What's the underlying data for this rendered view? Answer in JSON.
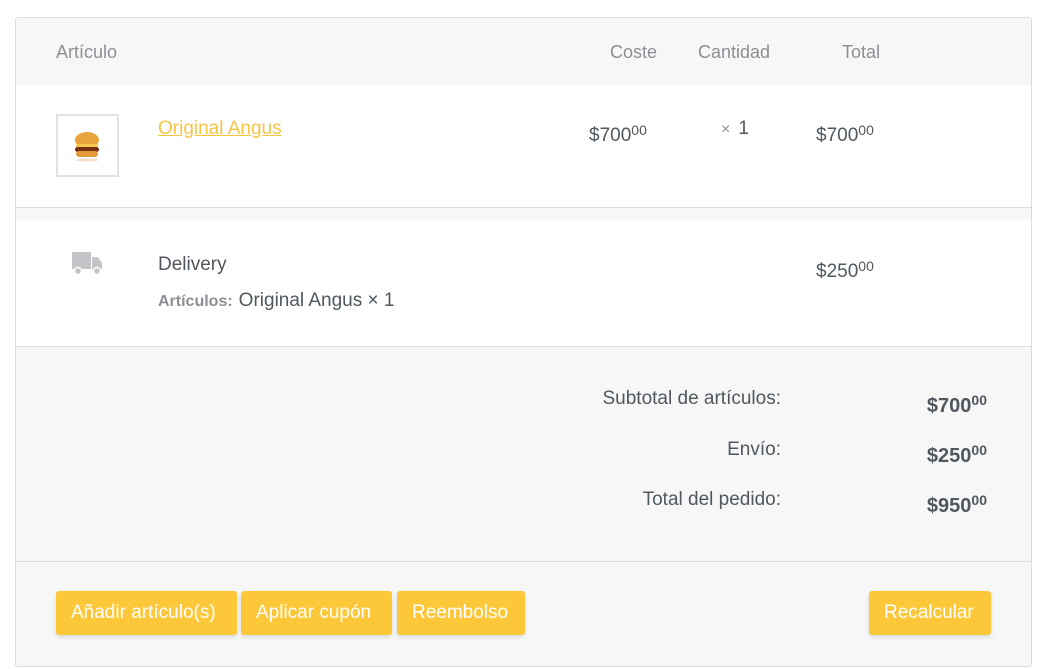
{
  "header": {
    "item": "Artículo",
    "cost": "Coste",
    "quantity": "Cantidad",
    "total": "Total"
  },
  "item": {
    "image_icon": "burger-image",
    "name": "Original Angus",
    "cost": "$700",
    "cost_cents": "00",
    "qty_symbol": "×",
    "qty": "1",
    "total": "$700",
    "total_cents": "00"
  },
  "shipping": {
    "icon": "truck-icon",
    "name": "Delivery",
    "items_label": "Artículos:",
    "items_value": "Original Angus × 1",
    "total": "$250",
    "total_cents": "00"
  },
  "totals": {
    "subtotal_label": "Subtotal de artículos:",
    "subtotal": "$700",
    "subtotal_cents": "00",
    "shipping_label": "Envío:",
    "shipping": "$250",
    "shipping_cents": "00",
    "order_label": "Total del pedido:",
    "order": "$950",
    "order_cents": "00"
  },
  "actions": {
    "add_items": "Añadir artículo(s)",
    "apply_coupon": "Aplicar cupón",
    "refund": "Reembolso",
    "recalculate": "Recalcular"
  },
  "colors": {
    "accent": "#fdc73a",
    "link": "#f7c544"
  }
}
